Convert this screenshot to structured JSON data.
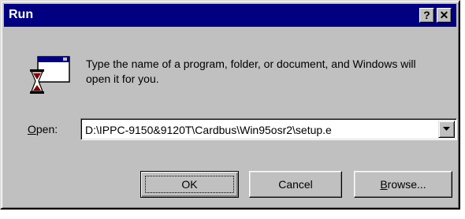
{
  "window": {
    "title": "Run",
    "help_label": "?",
    "close_label": "✕",
    "title_bar_color": "#000080",
    "face_color": "#c0c0c0"
  },
  "icon": {
    "name": "run-program-icon"
  },
  "message": "Type the name of a program, folder, or document, and Windows will open it for you.",
  "open_field": {
    "label_mnemonic": "O",
    "label_rest": "pen:",
    "value": "D:\\IPPC-9150&9120T\\Cardbus\\Win95osr2\\setup.e"
  },
  "buttons": {
    "ok": "OK",
    "cancel": "Cancel",
    "browse_mnemonic": "B",
    "browse_rest": "rowse..."
  }
}
